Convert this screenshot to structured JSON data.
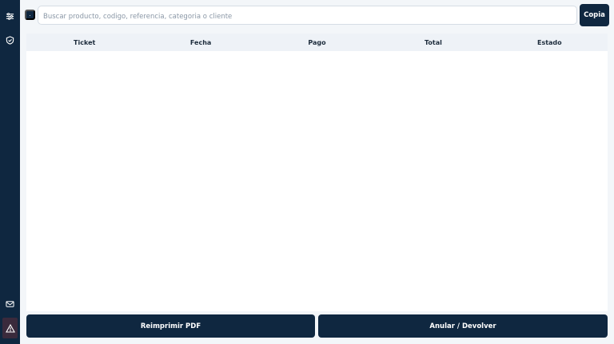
{
  "sidebar": {
    "items": [
      {
        "icon": "sliders-icon"
      },
      {
        "icon": "shield-check-icon"
      },
      {
        "icon": "mail-icon"
      },
      {
        "icon": "warning-icon"
      }
    ]
  },
  "toolbar": {
    "mini_button_label": "·",
    "search_placeholder": "Buscar producto, codigo, referencia, categoria o cliente",
    "copy_label": "Copia"
  },
  "table": {
    "columns": [
      "Ticket",
      "Fecha",
      "Pago",
      "Total",
      "Estado"
    ],
    "rows": []
  },
  "actions": {
    "reprint_label": "Reimprimir PDF",
    "void_label": "Anular / Devolver"
  },
  "colors": {
    "navy": "#0f2740",
    "background": "#f3f6f9",
    "header_bg": "#eef2f7"
  }
}
